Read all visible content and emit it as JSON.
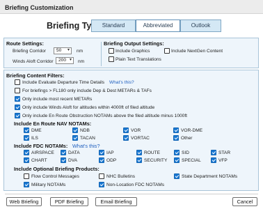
{
  "window": {
    "title": "Briefing Customization"
  },
  "briefing_type": {
    "label": "Briefing Type:",
    "options": [
      "Standard",
      "Abbreviated",
      "Outlook"
    ],
    "selected": "Abbreviated"
  },
  "route_settings": {
    "title": "Route Settings:",
    "corridor_label": "Briefing Corridor",
    "corridor_value": "50",
    "corridor_unit": "nm",
    "winds_label": "Winds Aloft Corridor",
    "winds_value": "200",
    "winds_unit": "nm"
  },
  "output_settings": {
    "title": "Briefing Output Settings:",
    "include_graphics": {
      "label": "Include Graphics",
      "checked": false
    },
    "nextgen": {
      "label": "Include NextGen Content",
      "checked": false
    },
    "plain_text": {
      "label": "Plain Text Translations",
      "checked": false
    }
  },
  "content_filters": {
    "title": "Briefing Content Filters:",
    "items": [
      {
        "label": "Include Evaluate Departure Time Details",
        "link": "What's this?",
        "checked": false
      },
      {
        "label": "For briefings > FL180 only include Dep & Dest METARs & TAFs",
        "checked": false
      },
      {
        "label": "Only include most recent METARs",
        "checked": true
      },
      {
        "label": "Only include Winds Aloft for altitudes within 4000ft of filed altitude",
        "checked": true
      },
      {
        "label": "Only include En Route Obstruction NOTAMs above the filed altitude minus 1000ft",
        "checked": true
      }
    ]
  },
  "nav_notams": {
    "title": "Include En Route NAV NOTAMs:",
    "items": [
      {
        "label": "DME",
        "checked": true
      },
      {
        "label": "NDB",
        "checked": true
      },
      {
        "label": "VOR",
        "checked": true
      },
      {
        "label": "VOR-DME",
        "checked": true
      },
      {
        "label": "ILS",
        "checked": true
      },
      {
        "label": "TACAN",
        "checked": true
      },
      {
        "label": "VORTAC",
        "checked": true
      },
      {
        "label": "Other",
        "checked": true
      }
    ]
  },
  "fdc_notams": {
    "title": "Include FDC NOTAMs:",
    "link": "What's this?",
    "items": [
      {
        "label": "AIRSPACE",
        "checked": true
      },
      {
        "label": "DATA",
        "checked": true
      },
      {
        "label": "IAP",
        "checked": true
      },
      {
        "label": "ROUTE",
        "checked": true
      },
      {
        "label": "SID",
        "checked": true
      },
      {
        "label": "STAR",
        "checked": true
      },
      {
        "label": "CHART",
        "checked": true
      },
      {
        "label": "DVA",
        "checked": true
      },
      {
        "label": "ODP",
        "checked": true
      },
      {
        "label": "SECURITY",
        "checked": true
      },
      {
        "label": "SPECIAL",
        "checked": true
      },
      {
        "label": "VFP",
        "checked": true
      }
    ]
  },
  "optional_products": {
    "title": "Include Optional Briefing Products:",
    "items": [
      {
        "label": "Flow Control Messages",
        "checked": false
      },
      {
        "label": "NHC Bulletins",
        "checked": false
      },
      {
        "label": "State Department NOTAMs",
        "checked": true
      },
      {
        "label": "Military NOTAMs",
        "checked": true
      },
      {
        "label": "Non-Location FDC NOTAMs",
        "checked": true
      }
    ]
  },
  "footer": {
    "web_briefing": "Web Briefing",
    "pdf_briefing": "PDF Briefing",
    "email_briefing": "Email Briefing",
    "cancel": "Cancel"
  },
  "colors": {
    "accent": "#1877d2",
    "panel_bg": "#eef5fb",
    "panel_border": "#a8c4d8"
  }
}
